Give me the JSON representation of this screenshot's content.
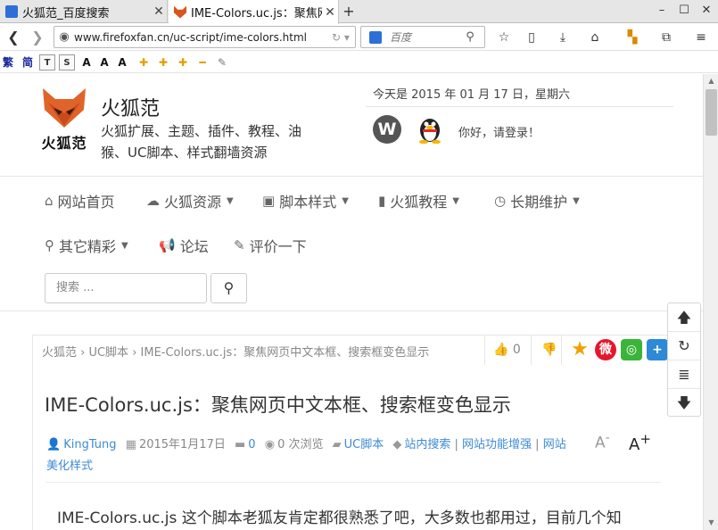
{
  "tabs": [
    {
      "title": "火狐范_百度搜索"
    },
    {
      "title": "IME-Colors.uc.js：聚焦网页中文本框、搜索框变色显示"
    }
  ],
  "url": "www.firefoxfan.cn/uc-script/ime-colors.html",
  "search_engine_placeholder": "百度",
  "extension_labels": [
    "繁",
    "简",
    "T",
    "S",
    "A",
    "A",
    "A"
  ],
  "site": {
    "logo_text": "火狐范",
    "name": "火狐范",
    "description": "火狐扩展、主题、插件、教程、油猴、UC脚本、样式翻墙资源",
    "date": "今天是 2015 年 01 月 17 日，星期六",
    "wp_letter": "W",
    "login": "你好，请登录！"
  },
  "menu": [
    {
      "label": "网站首页",
      "icon": "home-icon"
    },
    {
      "label": "火狐资源",
      "icon": "cloud-download-icon"
    },
    {
      "label": "脚本样式",
      "icon": "image-icon"
    },
    {
      "label": "火狐教程",
      "icon": "book-icon"
    },
    {
      "label": "长期维护",
      "icon": "clock-icon"
    },
    {
      "label": "其它精彩",
      "icon": "map-marker-icon"
    },
    {
      "label": "论坛",
      "icon": "bullhorn-icon"
    },
    {
      "label": "评价一下",
      "icon": "edit-icon"
    }
  ],
  "search": {
    "placeholder": "搜索 ..."
  },
  "breadcrumb": "火狐范 › UC脚本 › IME-Colors.uc.js：聚焦网页中文本框、搜索框变色显示",
  "likes": "0",
  "article": {
    "title": "IME-Colors.uc.js：聚焦网页中文本框、搜索框变色显示",
    "author": "KingTung",
    "date": "2015年1月17日",
    "comments": "0",
    "views": "0 次浏览",
    "category": "UC脚本",
    "tag1": "站内搜索",
    "tag2": "网站功能增强",
    "tag3": "网站",
    "tag4": "美化样式",
    "font_small": "A",
    "font_large": "A",
    "body": "IME-Colors.uc.js 这个脚本老狐友肯定都很熟悉了吧，大多数也都用过，目前几个知"
  },
  "colors": {
    "accent": "#3d8bd4",
    "fox": "#d9541e"
  }
}
